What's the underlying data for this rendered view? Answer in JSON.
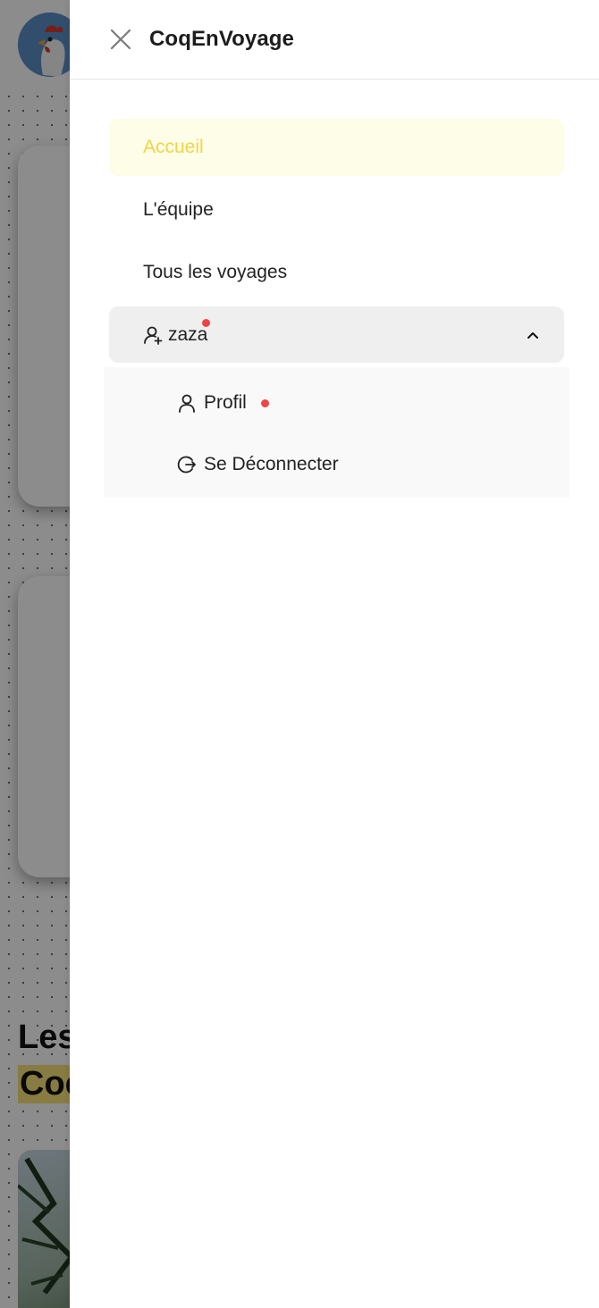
{
  "drawer": {
    "title": "CoqEnVoyage",
    "close_icon": "close-icon"
  },
  "nav": {
    "items": [
      {
        "label": "Accueil",
        "active": true
      },
      {
        "label": "L'équipe",
        "active": false
      },
      {
        "label": "Tous les voyages",
        "active": false
      }
    ],
    "user": {
      "name": "zaza",
      "icon": "user-plus-icon",
      "expanded": true,
      "has_notification": true,
      "submenu": [
        {
          "label": "Profil",
          "icon": "user-icon",
          "has_notification": true
        },
        {
          "label": "Se Déconnecter",
          "icon": "logout-icon",
          "has_notification": false
        }
      ]
    }
  },
  "background": {
    "heading_line1": "Les",
    "heading_line2": "Coc"
  },
  "colors": {
    "active_text": "#f1d542",
    "active_bg": "#fdfde8",
    "notification": "#ef4444",
    "user_bg": "#efefef",
    "submenu_bg": "#f9f9f9"
  }
}
